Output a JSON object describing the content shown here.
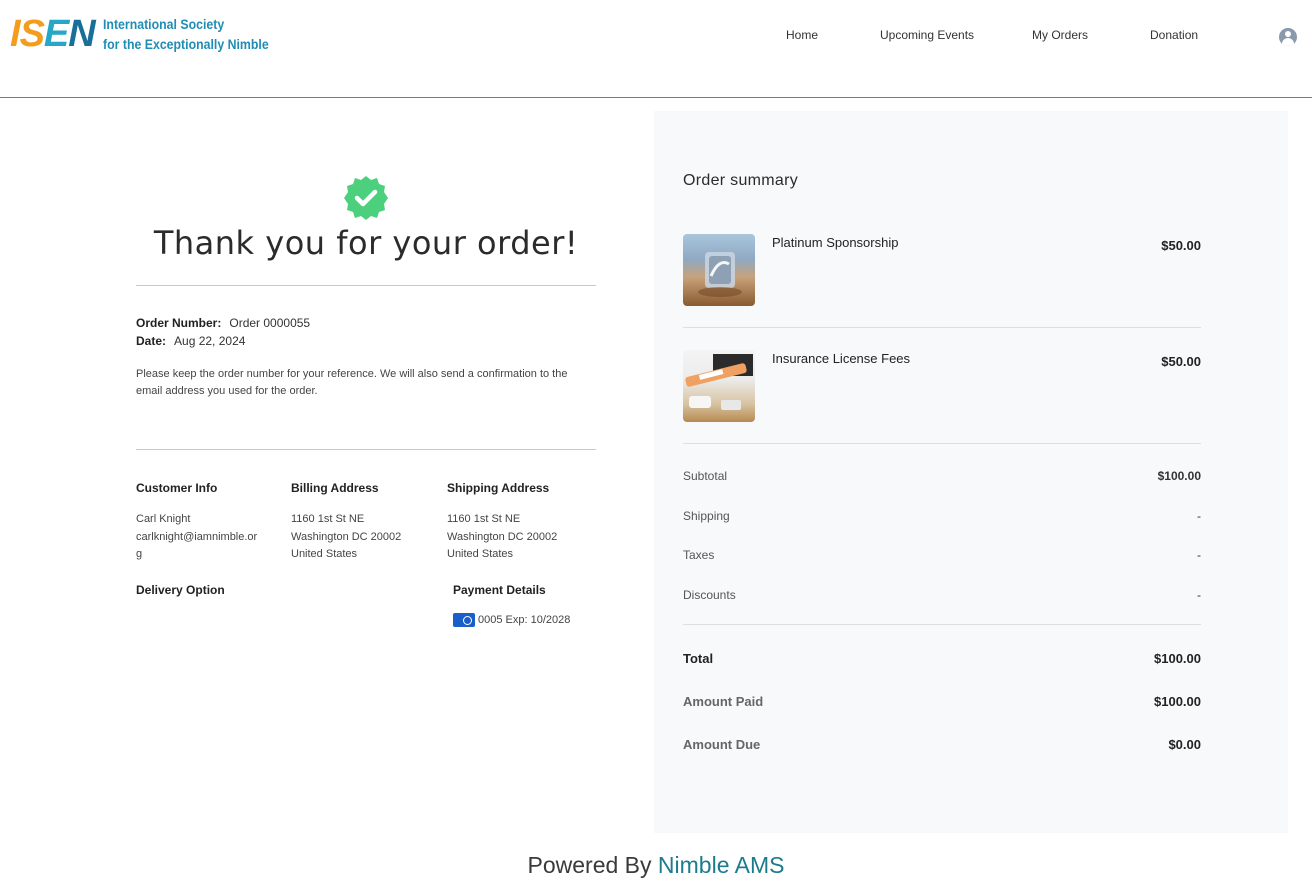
{
  "header": {
    "logo_letters": [
      "I",
      "S",
      "E",
      "N"
    ],
    "logo_line1": "International Society",
    "logo_line2": "for the Exceptionally Nimble",
    "nav": {
      "home": "Home",
      "events": "Upcoming Events",
      "orders": "My Orders",
      "donation": "Donation"
    }
  },
  "confirmation": {
    "heading": "Thank you for your order!",
    "order_number_label": "Order Number:",
    "order_number": "Order 0000055",
    "date_label": "Date:",
    "date": "Aug 22, 2024",
    "reference_note": "Please keep the order number for your reference. We will also send a confirmation to the email address you used for the order.",
    "customer_info": {
      "title": "Customer Info",
      "name": "Carl Knight",
      "email": "carlknight@iamnimble.org"
    },
    "billing_address": {
      "title": "Billing Address",
      "line1": "1160 1st St NE",
      "line2": "Washington DC 20002",
      "line3": "United States"
    },
    "shipping_address": {
      "title": "Shipping Address",
      "line1": "1160 1st St NE",
      "line2": "Washington DC 20002",
      "line3": "United States"
    },
    "delivery_option_title": "Delivery Option",
    "payment_details": {
      "title": "Payment Details",
      "card_text": "0005 Exp: 10/2028"
    }
  },
  "summary": {
    "title": "Order summary",
    "items": [
      {
        "name": "Platinum Sponsorship",
        "price": "$50.00"
      },
      {
        "name": "Insurance License Fees",
        "price": "$50.00"
      }
    ],
    "subtotal_label": "Subtotal",
    "subtotal": "$100.00",
    "shipping_label": "Shipping",
    "shipping": "-",
    "taxes_label": "Taxes",
    "taxes": "-",
    "discounts_label": "Discounts",
    "discounts": "-",
    "total_label": "Total",
    "total": "$100.00",
    "paid_label": "Amount Paid",
    "paid": "$100.00",
    "due_label": "Amount Due",
    "due": "$0.00"
  },
  "footer": {
    "prefix": "Powered By",
    "brand": "Nimble AMS"
  },
  "colors": {
    "accent_green": "#4cd07d",
    "brand_teal": "#1c7c8c",
    "panel_bg": "#f8f9fa"
  }
}
